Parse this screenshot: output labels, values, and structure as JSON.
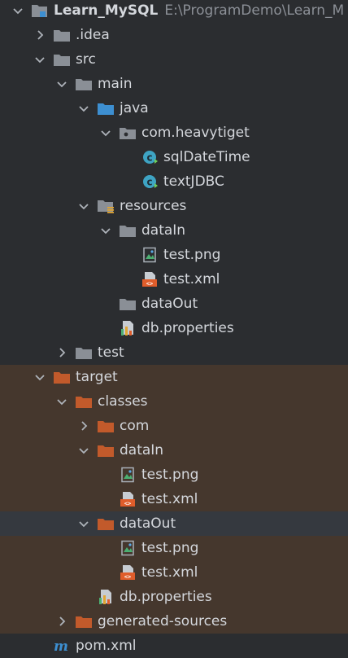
{
  "project": {
    "name": "Learn_MySQL",
    "path": "E:\\ProgramDemo\\Learn_M"
  },
  "colors": {
    "folder_gray": "#8a8f96",
    "folder_blue": "#3d8fd1",
    "folder_orange": "#c25a2b",
    "excluded_bg": "#45372d",
    "selected_bg": "#35393f",
    "class_icon": "#3ea4c4"
  },
  "rows": [
    {
      "label": "Learn_MySQL",
      "path": "E:\\ProgramDemo\\Learn_M",
      "depth": 0,
      "toggle": "open",
      "icon": "module-folder-icon",
      "name": "tree-node-learn-mysql",
      "root": true
    },
    {
      "label": ".idea",
      "depth": 1,
      "toggle": "closed",
      "icon": "folder-icon",
      "name": "tree-node-idea"
    },
    {
      "label": "src",
      "depth": 1,
      "toggle": "open",
      "icon": "folder-icon",
      "name": "tree-node-src"
    },
    {
      "label": "main",
      "depth": 2,
      "toggle": "open",
      "icon": "folder-icon",
      "name": "tree-node-main"
    },
    {
      "label": "java",
      "depth": 3,
      "toggle": "open",
      "icon": "source-folder-icon",
      "name": "tree-node-java"
    },
    {
      "label": "com.heavytiget",
      "depth": 4,
      "toggle": "open",
      "icon": "package-icon",
      "name": "tree-node-package"
    },
    {
      "label": "sqlDateTime",
      "depth": 5,
      "toggle": "none",
      "icon": "java-class-icon",
      "name": "tree-node-sqldatetime"
    },
    {
      "label": "textJDBC",
      "depth": 5,
      "toggle": "none",
      "icon": "java-class-icon",
      "name": "tree-node-textjdbc"
    },
    {
      "label": "resources",
      "depth": 3,
      "toggle": "open",
      "icon": "resources-folder-icon",
      "name": "tree-node-resources"
    },
    {
      "label": "dataIn",
      "depth": 4,
      "toggle": "open",
      "icon": "folder-icon",
      "name": "tree-node-datain"
    },
    {
      "label": "test.png",
      "depth": 5,
      "toggle": "none",
      "icon": "image-file-icon",
      "name": "tree-node-test-png"
    },
    {
      "label": "test.xml",
      "depth": 5,
      "toggle": "none",
      "icon": "xml-file-icon",
      "name": "tree-node-test-xml"
    },
    {
      "label": "dataOut",
      "depth": 4,
      "toggle": "none",
      "icon": "folder-icon",
      "name": "tree-node-dataout"
    },
    {
      "label": "db.properties",
      "depth": 4,
      "toggle": "none",
      "icon": "properties-file-icon",
      "name": "tree-node-db-properties"
    },
    {
      "label": "test",
      "depth": 2,
      "toggle": "closed",
      "icon": "folder-icon",
      "name": "tree-node-test"
    },
    {
      "label": "target",
      "depth": 1,
      "toggle": "open",
      "icon": "excluded-folder-icon",
      "name": "tree-node-target",
      "excluded": true
    },
    {
      "label": "classes",
      "depth": 2,
      "toggle": "open",
      "icon": "excluded-folder-icon",
      "name": "tree-node-classes",
      "excluded": true
    },
    {
      "label": "com",
      "depth": 3,
      "toggle": "closed",
      "icon": "excluded-folder-icon",
      "name": "tree-node-com",
      "excluded": true
    },
    {
      "label": "dataIn",
      "depth": 3,
      "toggle": "open",
      "icon": "excluded-folder-icon",
      "name": "tree-node-target-datain",
      "excluded": true
    },
    {
      "label": "test.png",
      "depth": 4,
      "toggle": "none",
      "icon": "image-file-icon",
      "name": "tree-node-target-test-png",
      "excluded": true
    },
    {
      "label": "test.xml",
      "depth": 4,
      "toggle": "none",
      "icon": "xml-file-icon",
      "name": "tree-node-target-test-xml",
      "excluded": true
    },
    {
      "label": "dataOut",
      "depth": 3,
      "toggle": "open",
      "icon": "excluded-folder-icon",
      "name": "tree-node-target-dataout",
      "selected": true
    },
    {
      "label": "test.png",
      "depth": 4,
      "toggle": "none",
      "icon": "image-file-icon",
      "name": "tree-node-target-dataout-test-png",
      "excluded": true
    },
    {
      "label": "test.xml",
      "depth": 4,
      "toggle": "none",
      "icon": "xml-file-icon",
      "name": "tree-node-target-dataout-test-xml",
      "excluded": true
    },
    {
      "label": "db.properties",
      "depth": 3,
      "toggle": "none",
      "icon": "properties-file-icon",
      "name": "tree-node-target-db-properties",
      "excluded": true
    },
    {
      "label": "generated-sources",
      "depth": 2,
      "toggle": "closed",
      "icon": "excluded-folder-icon",
      "name": "tree-node-generated-sources",
      "excluded": true
    },
    {
      "label": "pom.xml",
      "depth": 1,
      "toggle": "none",
      "icon": "maven-file-icon",
      "name": "tree-node-pom-xml"
    }
  ]
}
